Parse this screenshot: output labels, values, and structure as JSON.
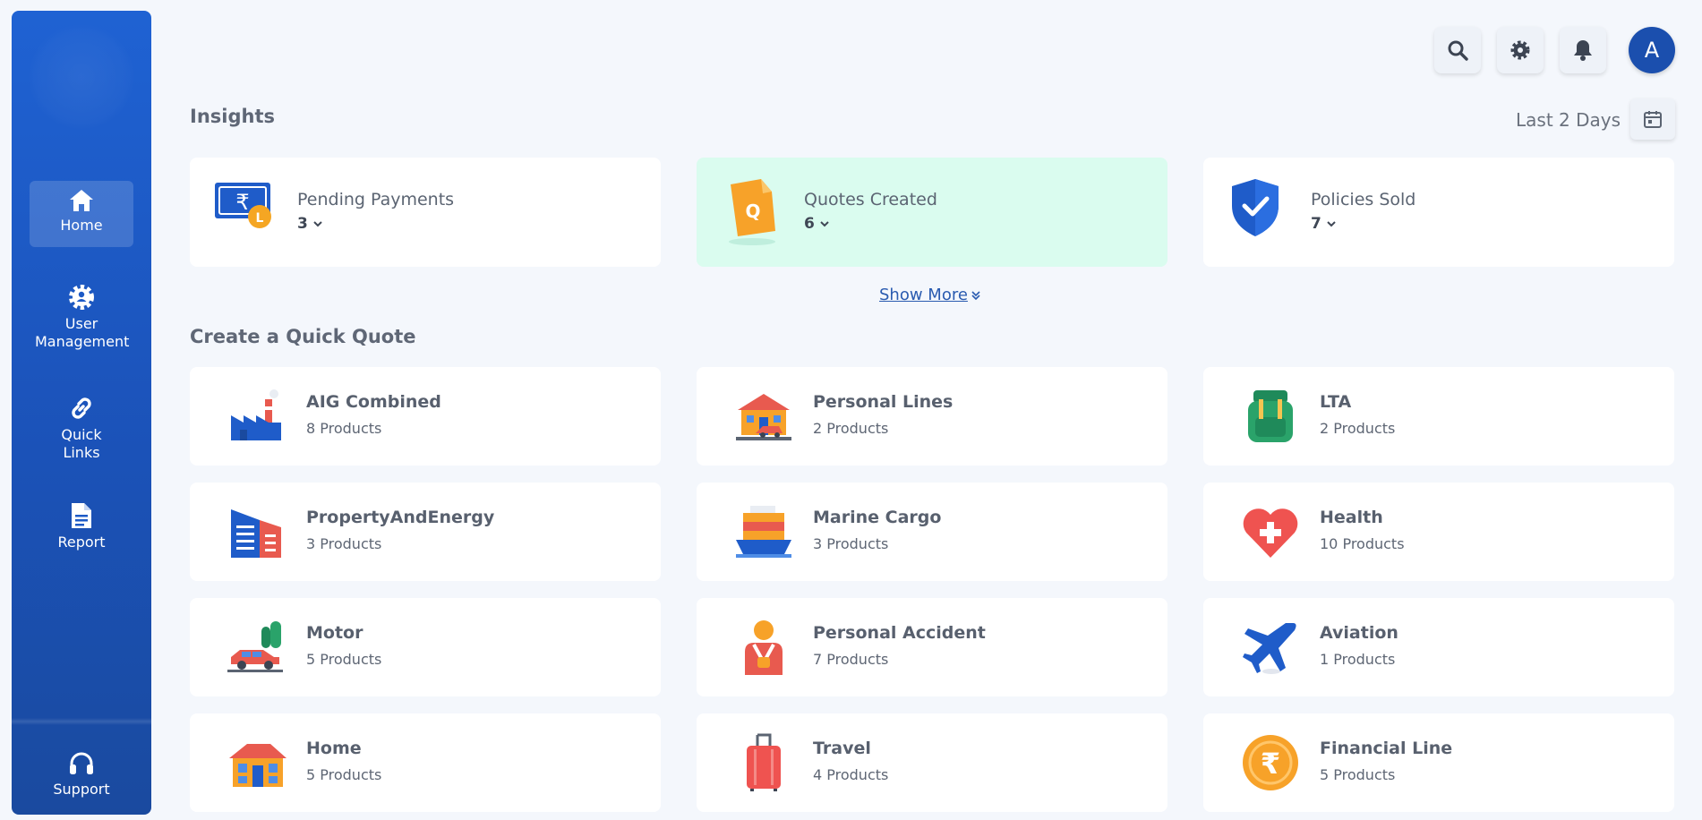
{
  "sidebar": {
    "items": [
      {
        "label": "Home",
        "icon": "home-icon"
      },
      {
        "label": "User Management",
        "icon": "user-gear-icon"
      },
      {
        "label": "Quick Links",
        "icon": "link-icon"
      },
      {
        "label": "Report",
        "icon": "document-icon"
      }
    ],
    "support": {
      "label": "Support",
      "icon": "headset-icon"
    }
  },
  "topbar": {
    "avatar_initial": "A",
    "icons": [
      "search-icon",
      "gear-icon",
      "bell-icon"
    ]
  },
  "insights": {
    "title": "Insights",
    "range": "Last 2 Days",
    "cards": [
      {
        "label": "Pending Payments",
        "value": "3",
        "icon": "payment-clock-icon"
      },
      {
        "label": "Quotes Created",
        "value": "6",
        "icon": "quote-document-icon"
      },
      {
        "label": "Policies Sold",
        "value": "7",
        "icon": "shield-check-icon"
      }
    ],
    "show_more": "Show More"
  },
  "quick_quote": {
    "title": "Create a Quick Quote",
    "items": [
      {
        "name": "AIG Combined",
        "count": "8 Products",
        "icon": "factory-icon"
      },
      {
        "name": "Personal Lines",
        "count": "2 Products",
        "icon": "house-car-icon"
      },
      {
        "name": "LTA",
        "count": "2 Products",
        "icon": "backpack-icon"
      },
      {
        "name": "PropertyAndEnergy",
        "count": "3 Products",
        "icon": "building-icon"
      },
      {
        "name": "Marine Cargo",
        "count": "3 Products",
        "icon": "cargo-ship-icon"
      },
      {
        "name": "Health",
        "count": "10 Products",
        "icon": "heart-plus-icon"
      },
      {
        "name": "Motor",
        "count": "5 Products",
        "icon": "car-icon"
      },
      {
        "name": "Personal Accident",
        "count": "7 Products",
        "icon": "person-sling-icon"
      },
      {
        "name": "Aviation",
        "count": "1 Products",
        "icon": "airplane-icon"
      },
      {
        "name": "Home",
        "count": "5 Products",
        "icon": "house-icon"
      },
      {
        "name": "Travel",
        "count": "4 Products",
        "icon": "luggage-icon"
      },
      {
        "name": "Financial Line",
        "count": "5 Products",
        "icon": "rupee-coin-icon"
      }
    ]
  },
  "colors": {
    "sidebar": "#1f62d3",
    "background": "#f4f7fc",
    "highlight_card": "#dafcef",
    "link": "#2a5bb0"
  }
}
